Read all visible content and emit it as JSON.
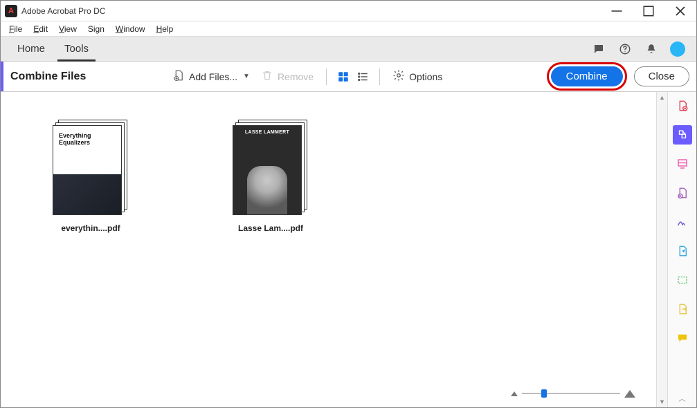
{
  "app": {
    "title": "Adobe Acrobat Pro DC",
    "logo_glyph": "A"
  },
  "menu": {
    "file": "File",
    "edit": "Edit",
    "view": "View",
    "sign": "Sign",
    "window": "Window",
    "help": "Help"
  },
  "tabs": {
    "home": "Home",
    "tools": "Tools",
    "active": "tools"
  },
  "toolbar": {
    "title": "Combine Files",
    "add_files": "Add Files...",
    "remove": "Remove",
    "options": "Options",
    "combine": "Combine",
    "close": "Close"
  },
  "files": [
    {
      "caption": "everythin....pdf",
      "thumb_title_line1": "Everything",
      "thumb_title_line2": "Equalizers",
      "kind": "doc"
    },
    {
      "caption": "Lasse Lam....pdf",
      "thumb_band": "LASSE LAMMERT",
      "kind": "dark"
    }
  ],
  "right_icons": {
    "chat": "chat-icon",
    "help": "help-icon",
    "bell": "bell-icon",
    "avatar": "avatar"
  },
  "side_tools": [
    {
      "name": "create-pdf-icon",
      "selected": false,
      "color": "#e1374a"
    },
    {
      "name": "combine-files-icon",
      "selected": true,
      "color": "#ffffff"
    },
    {
      "name": "edit-pdf-icon",
      "selected": false,
      "color": "#ef4fa6"
    },
    {
      "name": "export-pdf-icon",
      "selected": false,
      "color": "#9b59b6"
    },
    {
      "name": "sign-icon",
      "selected": false,
      "color": "#7558d6"
    },
    {
      "name": "send-review-icon",
      "selected": false,
      "color": "#2aa5e0"
    },
    {
      "name": "measure-icon",
      "selected": false,
      "color": "#59c16a"
    },
    {
      "name": "stamp-icon",
      "selected": false,
      "color": "#e7c23b"
    },
    {
      "name": "comment-icon",
      "selected": false,
      "color": "#f2c409"
    }
  ],
  "zoom": {
    "value_pct": 20
  }
}
